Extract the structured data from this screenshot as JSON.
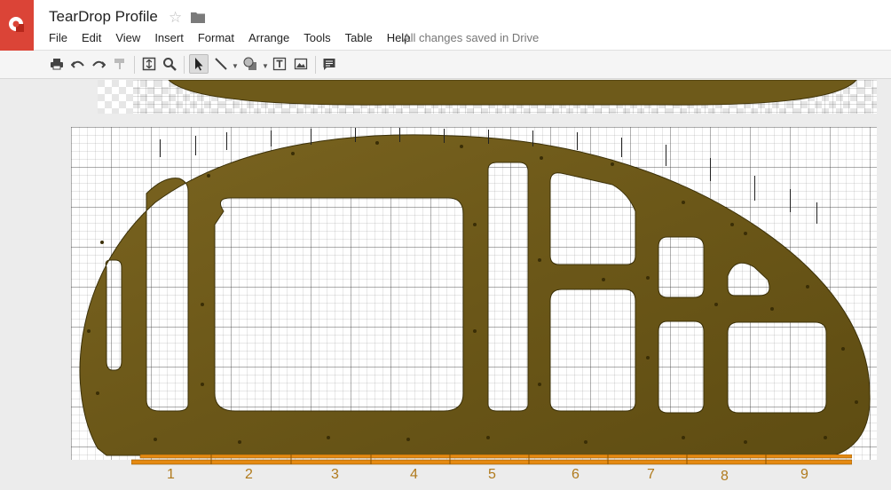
{
  "header": {
    "title": "TearDrop Profile",
    "save_status": "All changes saved in Drive"
  },
  "menu": {
    "items": [
      "File",
      "Edit",
      "View",
      "Insert",
      "Format",
      "Arrange",
      "Tools",
      "Table",
      "Help"
    ]
  },
  "toolbar": {
    "buttons": [
      "print-icon",
      "undo-icon",
      "redo-icon",
      "paint-format-icon",
      "zoom-fit-icon",
      "zoom-icon",
      "select-icon",
      "line-icon",
      "shape-icon",
      "text-box-icon",
      "image-icon",
      "comment-icon"
    ],
    "active": "select-icon"
  },
  "ruler": {
    "labels": [
      "1",
      "2",
      "3",
      "4",
      "5",
      "6",
      "7",
      "8",
      "9"
    ]
  },
  "colors": {
    "logo": "#db4437",
    "wood": "#6e5a1a",
    "ruler": "#e58a12",
    "ruler_text": "#b07a1c"
  }
}
